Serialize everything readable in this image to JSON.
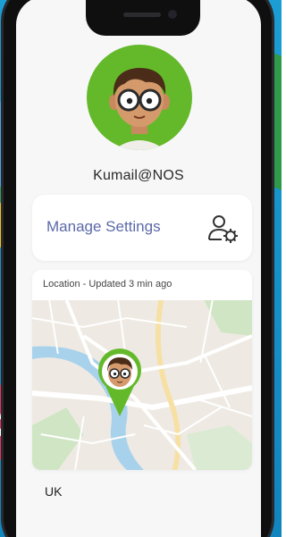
{
  "profile": {
    "username": "Kumail@NOS"
  },
  "settings": {
    "label": "Manage Settings",
    "icon": "user-settings-icon"
  },
  "location": {
    "header": "Location - Updated 3 min ago",
    "country": "UK"
  },
  "colors": {
    "background": "#1594cc",
    "avatar_ring": "#64b92a",
    "settings_text": "#5b6aa8",
    "pin": "#64b92a"
  }
}
